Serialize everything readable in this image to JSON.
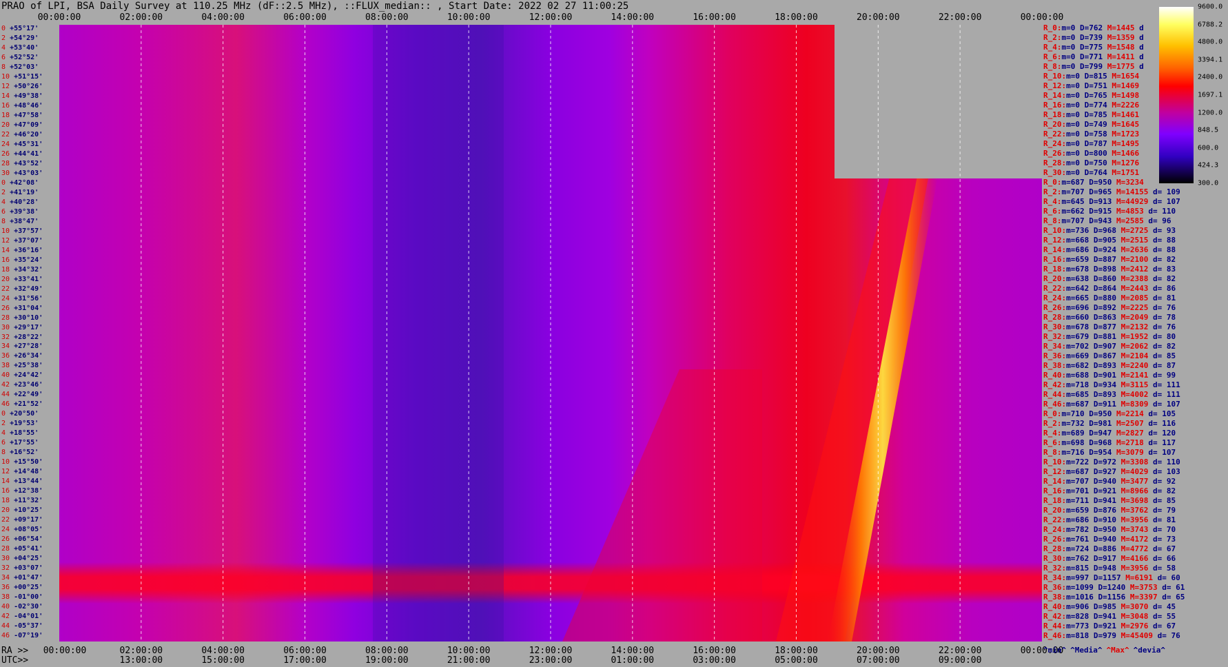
{
  "title": "PRAO of LPI, BSA Daily Survey at 110.25 MHz (dF::2.5 MHz), ::FLUX_median:: , Start Date: 2022 02 27 11:00:25",
  "chart_data": {
    "type": "heatmap",
    "title": "PRAO of LPI, BSA Daily Survey at 110.25 MHz (dF::2.5 MHz), ::FLUX_median:: , Start Date: 2022 02 27 11:00:25",
    "x_top_ticks": [
      "00:00:00",
      "02:00:00",
      "04:00:00",
      "06:00:00",
      "08:00:00",
      "10:00:00",
      "12:00:00",
      "14:00:00",
      "16:00:00",
      "18:00:00",
      "20:00:00",
      "22:00:00",
      "00:00:00"
    ],
    "x_ra_label": "RA >>",
    "x_ra_ticks": [
      "00:00:00",
      "02:00:00",
      "04:00:00",
      "06:00:00",
      "08:00:00",
      "10:00:00",
      "12:00:00",
      "14:00:00",
      "16:00:00",
      "18:00:00",
      "20:00:00",
      "22:00:00",
      "00:00:00"
    ],
    "x_utc_label": "UTC>>",
    "x_utc_ticks": [
      "13:00:00",
      "15:00:00",
      "17:00:00",
      "19:00:00",
      "21:00:00",
      "23:00:00",
      "01:00:00",
      "03:00:00",
      "05:00:00",
      "07:00:00",
      "09:00:00"
    ],
    "x_range_hours": [
      0,
      24
    ],
    "dec_labels": [
      {
        "n": "0",
        "dec": "+55°17'"
      },
      {
        "n": "2",
        "dec": "+54°29'"
      },
      {
        "n": "4",
        "dec": "+53°40'"
      },
      {
        "n": "6",
        "dec": "+52°52'"
      },
      {
        "n": "8",
        "dec": "+52°03'"
      },
      {
        "n": "10",
        "dec": "+51°15'"
      },
      {
        "n": "12",
        "dec": "+50°26'"
      },
      {
        "n": "14",
        "dec": "+49°38'"
      },
      {
        "n": "16",
        "dec": "+48°46'"
      },
      {
        "n": "18",
        "dec": "+47°58'"
      },
      {
        "n": "20",
        "dec": "+47°09'"
      },
      {
        "n": "22",
        "dec": "+46°20'"
      },
      {
        "n": "24",
        "dec": "+45°31'"
      },
      {
        "n": "26",
        "dec": "+44°41'"
      },
      {
        "n": "28",
        "dec": "+43°52'"
      },
      {
        "n": "30",
        "dec": "+43°03'"
      },
      {
        "n": "0",
        "dec": "+42°08'"
      },
      {
        "n": "2",
        "dec": "+41°19'"
      },
      {
        "n": "4",
        "dec": "+40°28'"
      },
      {
        "n": "6",
        "dec": "+39°38'"
      },
      {
        "n": "8",
        "dec": "+38°47'"
      },
      {
        "n": "10",
        "dec": "+37°57'"
      },
      {
        "n": "12",
        "dec": "+37°07'"
      },
      {
        "n": "14",
        "dec": "+36°16'"
      },
      {
        "n": "16",
        "dec": "+35°24'"
      },
      {
        "n": "18",
        "dec": "+34°32'"
      },
      {
        "n": "20",
        "dec": "+33°41'"
      },
      {
        "n": "22",
        "dec": "+32°49'"
      },
      {
        "n": "24",
        "dec": "+31°56'"
      },
      {
        "n": "26",
        "dec": "+31°04'"
      },
      {
        "n": "28",
        "dec": "+30°10'"
      },
      {
        "n": "30",
        "dec": "+29°17'"
      },
      {
        "n": "32",
        "dec": "+28°22'"
      },
      {
        "n": "34",
        "dec": "+27°28'"
      },
      {
        "n": "36",
        "dec": "+26°34'"
      },
      {
        "n": "38",
        "dec": "+25°38'"
      },
      {
        "n": "40",
        "dec": "+24°42'"
      },
      {
        "n": "42",
        "dec": "+23°46'"
      },
      {
        "n": "44",
        "dec": "+22°49'"
      },
      {
        "n": "46",
        "dec": "+21°52'"
      },
      {
        "n": "0",
        "dec": "+20°50'"
      },
      {
        "n": "2",
        "dec": "+19°53'"
      },
      {
        "n": "4",
        "dec": "+18°55'"
      },
      {
        "n": "6",
        "dec": "+17°55'"
      },
      {
        "n": "8",
        "dec": "+16°52'"
      },
      {
        "n": "10",
        "dec": "+15°50'"
      },
      {
        "n": "12",
        "dec": "+14°48'"
      },
      {
        "n": "14",
        "dec": "+13°44'"
      },
      {
        "n": "16",
        "dec": "+12°38'"
      },
      {
        "n": "18",
        "dec": "+11°32'"
      },
      {
        "n": "20",
        "dec": "+10°25'"
      },
      {
        "n": "22",
        "dec": "+09°17'"
      },
      {
        "n": "24",
        "dec": "+08°05'"
      },
      {
        "n": "26",
        "dec": "+06°54'"
      },
      {
        "n": "28",
        "dec": "+05°41'"
      },
      {
        "n": "30",
        "dec": "+04°25'"
      },
      {
        "n": "32",
        "dec": "+03°07'"
      },
      {
        "n": "34",
        "dec": "+01°47'"
      },
      {
        "n": "36",
        "dec": "+00°25'"
      },
      {
        "n": "38",
        "dec": "-01°00'"
      },
      {
        "n": "40",
        "dec": "-02°30'"
      },
      {
        "n": "42",
        "dec": "-04°01'"
      },
      {
        "n": "44",
        "dec": "-05°37'"
      },
      {
        "n": "46",
        "dec": "-07°19'"
      }
    ],
    "colorbar": {
      "labels": [
        "9600.0",
        "6788.2",
        "4800.0",
        "3394.1",
        "2400.0",
        "1697.1",
        "1200.0",
        "848.5",
        "600.0",
        "424.3",
        "300.0"
      ],
      "colors": [
        "#ffffff",
        "#ffff60",
        "#ffc000",
        "#ff6000",
        "#ff0000",
        "#c000a0",
        "#8000ff",
        "#3000c0",
        "#000000"
      ]
    },
    "stats": [
      {
        "r": "R_0:",
        "min": "0",
        "med": "762",
        "max": "1445",
        "dev": "d"
      },
      {
        "r": "R_2:",
        "min": "0",
        "med": "739",
        "max": "1359",
        "dev": "d"
      },
      {
        "r": "R_4:",
        "min": "0",
        "med": "775",
        "max": "1548",
        "dev": "d"
      },
      {
        "r": "R_6:",
        "min": "0",
        "med": "771",
        "max": "1411",
        "dev": "d"
      },
      {
        "r": "R_8:",
        "min": "0",
        "med": "799",
        "max": "1775",
        "dev": "d"
      },
      {
        "r": "R_10:",
        "min": "0",
        "med": "815",
        "max": "1654",
        "dev": ""
      },
      {
        "r": "R_12:",
        "min": "0",
        "med": "751",
        "max": "1469",
        "dev": ""
      },
      {
        "r": "R_14:",
        "min": "0",
        "med": "765",
        "max": "1498",
        "dev": ""
      },
      {
        "r": "R_16:",
        "min": "0",
        "med": "774",
        "max": "2226",
        "dev": ""
      },
      {
        "r": "R_18:",
        "min": "0",
        "med": "785",
        "max": "1461",
        "dev": ""
      },
      {
        "r": "R_20:",
        "min": "0",
        "med": "749",
        "max": "1645",
        "dev": ""
      },
      {
        "r": "R_22:",
        "min": "0",
        "med": "758",
        "max": "1723",
        "dev": ""
      },
      {
        "r": "R_24:",
        "min": "0",
        "med": "787",
        "max": "1495",
        "dev": ""
      },
      {
        "r": "R_26:",
        "min": "0",
        "med": "800",
        "max": "1466",
        "dev": ""
      },
      {
        "r": "R_28:",
        "min": "0",
        "med": "750",
        "max": "1276",
        "dev": ""
      },
      {
        "r": "R_30:",
        "min": "0",
        "med": "764",
        "max": "1751",
        "dev": ""
      },
      {
        "r": "R_0:",
        "min": "687",
        "med": "950",
        "max": "3234",
        "dev": ""
      },
      {
        "r": "R_2:",
        "min": "707",
        "med": "965",
        "max": "14155",
        "dev": "d= 109"
      },
      {
        "r": "R_4:",
        "min": "645",
        "med": "913",
        "max": "44929",
        "dev": "d= 107"
      },
      {
        "r": "R_6:",
        "min": "662",
        "med": "915",
        "max": "4853",
        "dev": "d= 110"
      },
      {
        "r": "R_8:",
        "min": "707",
        "med": "943",
        "max": "2585",
        "dev": "d= 96"
      },
      {
        "r": "R_10:",
        "min": "736",
        "med": "968",
        "max": "2725",
        "dev": "d= 93"
      },
      {
        "r": "R_12:",
        "min": "668",
        "med": "905",
        "max": "2515",
        "dev": "d= 88"
      },
      {
        "r": "R_14:",
        "min": "686",
        "med": "924",
        "max": "2636",
        "dev": "d= 88"
      },
      {
        "r": "R_16:",
        "min": "659",
        "med": "887",
        "max": "2100",
        "dev": "d= 82"
      },
      {
        "r": "R_18:",
        "min": "678",
        "med": "898",
        "max": "2412",
        "dev": "d= 83"
      },
      {
        "r": "R_20:",
        "min": "638",
        "med": "860",
        "max": "2388",
        "dev": "d= 82"
      },
      {
        "r": "R_22:",
        "min": "642",
        "med": "864",
        "max": "2443",
        "dev": "d= 86"
      },
      {
        "r": "R_24:",
        "min": "665",
        "med": "880",
        "max": "2085",
        "dev": "d= 81"
      },
      {
        "r": "R_26:",
        "min": "696",
        "med": "892",
        "max": "2225",
        "dev": "d= 76"
      },
      {
        "r": "R_28:",
        "min": "660",
        "med": "863",
        "max": "2049",
        "dev": "d= 78"
      },
      {
        "r": "R_30:",
        "min": "678",
        "med": "877",
        "max": "2132",
        "dev": "d= 76"
      },
      {
        "r": "R_32:",
        "min": "679",
        "med": "881",
        "max": "1952",
        "dev": "d= 80"
      },
      {
        "r": "R_34:",
        "min": "702",
        "med": "907",
        "max": "2062",
        "dev": "d= 82"
      },
      {
        "r": "R_36:",
        "min": "669",
        "med": "867",
        "max": "2104",
        "dev": "d= 85"
      },
      {
        "r": "R_38:",
        "min": "682",
        "med": "893",
        "max": "2240",
        "dev": "d= 87"
      },
      {
        "r": "R_40:",
        "min": "688",
        "med": "901",
        "max": "2141",
        "dev": "d= 99"
      },
      {
        "r": "R_42:",
        "min": "718",
        "med": "934",
        "max": "3115",
        "dev": "d= 111"
      },
      {
        "r": "R_44:",
        "min": "685",
        "med": "893",
        "max": "4002",
        "dev": "d= 111"
      },
      {
        "r": "R_46:",
        "min": "687",
        "med": "911",
        "max": "8309",
        "dev": "d= 107"
      },
      {
        "r": "R_0:",
        "min": "710",
        "med": "950",
        "max": "2214",
        "dev": "d= 105"
      },
      {
        "r": "R_2:",
        "min": "732",
        "med": "981",
        "max": "2507",
        "dev": "d= 116"
      },
      {
        "r": "R_4:",
        "min": "689",
        "med": "947",
        "max": "2827",
        "dev": "d= 120"
      },
      {
        "r": "R_6:",
        "min": "698",
        "med": "968",
        "max": "2718",
        "dev": "d= 117"
      },
      {
        "r": "R_8:",
        "min": "716",
        "med": "954",
        "max": "3079",
        "dev": "d= 107"
      },
      {
        "r": "R_10:",
        "min": "722",
        "med": "972",
        "max": "3308",
        "dev": "d= 110"
      },
      {
        "r": "R_12:",
        "min": "687",
        "med": "927",
        "max": "4029",
        "dev": "d= 103"
      },
      {
        "r": "R_14:",
        "min": "707",
        "med": "940",
        "max": "3477",
        "dev": "d= 92"
      },
      {
        "r": "R_16:",
        "min": "701",
        "med": "921",
        "max": "8966",
        "dev": "d= 82"
      },
      {
        "r": "R_18:",
        "min": "711",
        "med": "941",
        "max": "3698",
        "dev": "d= 85"
      },
      {
        "r": "R_20:",
        "min": "659",
        "med": "876",
        "max": "3762",
        "dev": "d= 79"
      },
      {
        "r": "R_22:",
        "min": "686",
        "med": "910",
        "max": "3956",
        "dev": "d= 81"
      },
      {
        "r": "R_24:",
        "min": "782",
        "med": "950",
        "max": "3743",
        "dev": "d= 70"
      },
      {
        "r": "R_26:",
        "min": "761",
        "med": "940",
        "max": "4172",
        "dev": "d= 73"
      },
      {
        "r": "R_28:",
        "min": "724",
        "med": "886",
        "max": "4772",
        "dev": "d= 67"
      },
      {
        "r": "R_30:",
        "min": "762",
        "med": "917",
        "max": "4166",
        "dev": "d= 66"
      },
      {
        "r": "R_32:",
        "min": "815",
        "med": "948",
        "max": "3956",
        "dev": "d= 58"
      },
      {
        "r": "R_34:",
        "min": "997",
        "med": "1157",
        "max": "6191",
        "dev": "d= 60"
      },
      {
        "r": "R_36:",
        "min": "1099",
        "med": "1240",
        "max": "3753",
        "dev": "d= 61"
      },
      {
        "r": "R_38:",
        "min": "1016",
        "med": "1156",
        "max": "3397",
        "dev": "d= 65"
      },
      {
        "r": "R_40:",
        "min": "906",
        "med": "985",
        "max": "3070",
        "dev": "d= 45"
      },
      {
        "r": "R_42:",
        "min": "828",
        "med": "941",
        "max": "3048",
        "dev": "d= 55"
      },
      {
        "r": "R_44:",
        "min": "773",
        "med": "921",
        "max": "2976",
        "dev": "d= 67"
      },
      {
        "r": "R_46:",
        "min": "818",
        "med": "979",
        "max": "45409",
        "dev": "d= 76"
      }
    ],
    "stat_prefixes": {
      "min": "m=",
      "med": "D=",
      "max": "M="
    },
    "legend": [
      "^min^",
      "^Media^",
      "^Max^",
      "^devia^"
    ]
  }
}
